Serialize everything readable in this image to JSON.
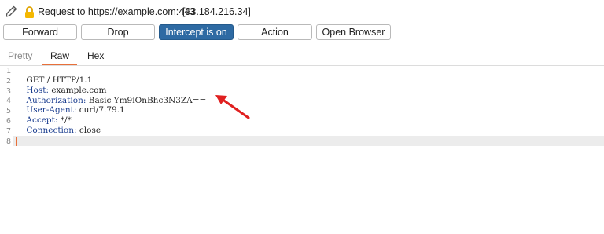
{
  "header": {
    "request_label": "Request to https://example.com:443",
    "ip": "[93.184.216.34]"
  },
  "toolbar": {
    "forward": "Forward",
    "drop": "Drop",
    "intercept": "Intercept is on",
    "action": "Action",
    "open_browser": "Open Browser"
  },
  "tabs": [
    "Pretty",
    "Raw",
    "Hex"
  ],
  "line_numbers": [
    "1",
    "2",
    "3",
    "4",
    "5",
    "6",
    "7",
    "8"
  ],
  "request_lines": {
    "line1": "GET / HTTP/1.1",
    "host_name": "Host:",
    "host_value": " example.com",
    "auth_name": "Authorization:",
    "auth_value": " Basic Ym9iOnBhc3N3ZA==",
    "ua_name": "User-Agent:",
    "ua_value": " curl/7.79.1",
    "accept_name": "Accept:",
    "accept_value": " */*",
    "conn_name": "Connection:",
    "conn_value": " close"
  },
  "colors": {
    "intercept_on": "#2e6aa3",
    "accent": "#e8703a",
    "arrow": "#e02020",
    "header_name": "#1a3d8f"
  },
  "icons": [
    "pencil-icon",
    "lock-icon",
    "red-arrow-annotation"
  ]
}
